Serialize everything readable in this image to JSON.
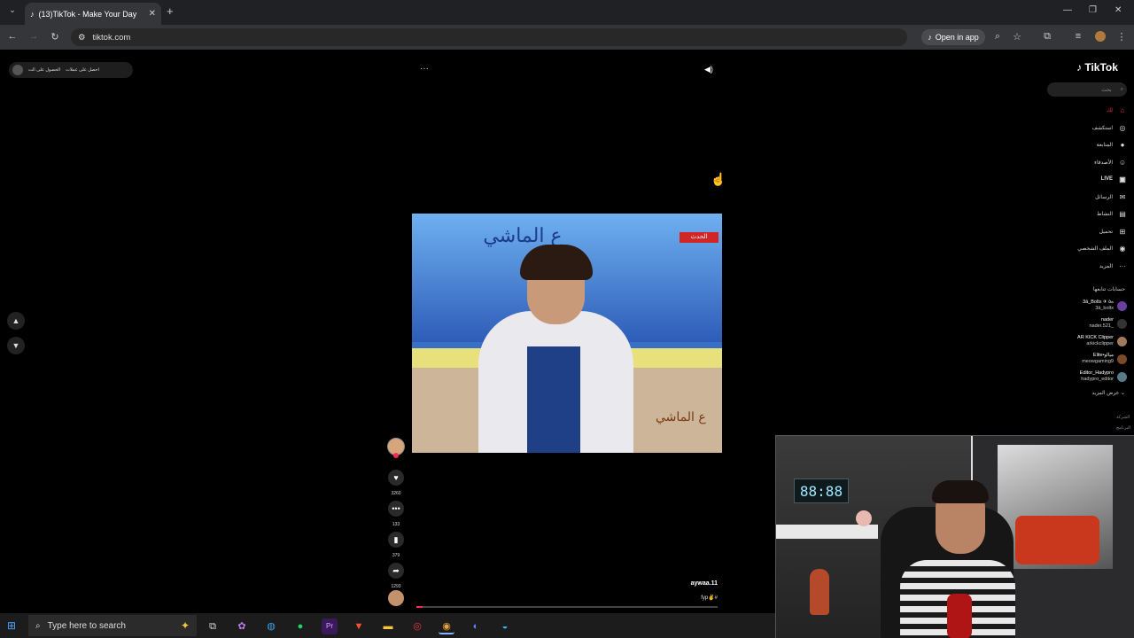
{
  "browser": {
    "tab_title": "(13)TikTok - Make Your Day",
    "tab_icon": "tiktok-icon",
    "url": "tiktok.com",
    "open_in_app": "Open in app"
  },
  "promo": {
    "get_coins": "احصل على عملات",
    "get_app": "الحصول على الت"
  },
  "video": {
    "username": "aywaa.11",
    "hashtag": "fyp✌#",
    "overlay_logo": "ع الماشي",
    "news_tag": "الحدث",
    "progress": 0.02
  },
  "actions": {
    "likes": "3260",
    "comments": "133",
    "saves": "379",
    "shares": "1293"
  },
  "sidebar": {
    "logo": "TikTok",
    "search_placeholder": "بحث",
    "nav": [
      {
        "label": "لك",
        "icon": "home-icon",
        "active": true
      },
      {
        "label": "استكشف",
        "icon": "compass-icon"
      },
      {
        "label": "المتابعة",
        "icon": "following-icon"
      },
      {
        "label": "الأصدقاء",
        "icon": "friends-icon"
      },
      {
        "label": "LIVE",
        "icon": "live-icon"
      },
      {
        "label": "الرسائل",
        "icon": "messages-icon"
      },
      {
        "label": "النشاط",
        "icon": "activity-icon"
      },
      {
        "label": "تحميل",
        "icon": "upload-icon"
      },
      {
        "label": "الملف الشخصي",
        "icon": "profile-icon"
      },
      {
        "label": "المزيد",
        "icon": "more-icon"
      }
    ],
    "following_header": "حسابات تتابعها",
    "accounts": [
      {
        "name": "3ā_Boltx ✈ ه٥",
        "handle": "3ā_boltx"
      },
      {
        "name": "nader",
        "handle": "nader.521_"
      },
      {
        "name": "AR KICK Clipper",
        "handle": "arkickclipper"
      },
      {
        "name": "Elite•ميااو",
        "handle": "meowgaming9"
      },
      {
        "name": "Editor_Hadypro",
        "handle": "hadypro_editor"
      }
    ],
    "see_more": "عرض المزيد",
    "footer1": "الشركة",
    "footer2": "البرنامج"
  },
  "webcam": {
    "clock": "88:88"
  },
  "taskbar": {
    "search_placeholder": "Type here to search"
  }
}
